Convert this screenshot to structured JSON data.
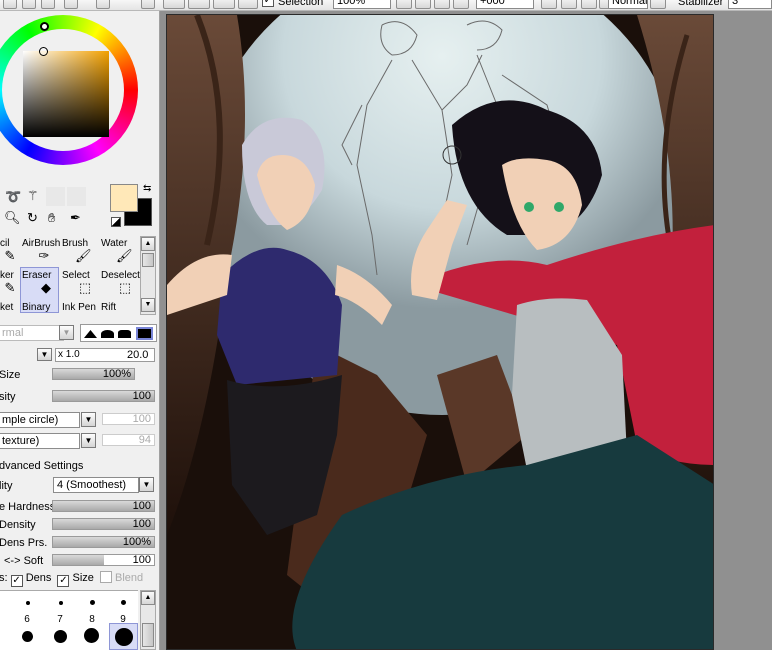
{
  "toolbar": {
    "selection_label": "Selection",
    "selection_checked": "✓",
    "zoom_value": "100%",
    "rotation_value": "+000°",
    "blend_mode": "Normal",
    "stabilizer_label": "Stabilizer",
    "stabilizer_value": "3"
  },
  "colors": {
    "primary": "#ffe8b8",
    "secondary": "#000000",
    "accent_selected": "#d8dcf6"
  },
  "tools": {
    "row1": [
      {
        "label": "cil",
        "icon": "pencil-icon"
      },
      {
        "label": "AirBrush",
        "icon": "airbrush-icon"
      },
      {
        "label": "Brush",
        "icon": "brush-icon"
      },
      {
        "label": "Water",
        "icon": "water-brush-icon"
      }
    ],
    "row2": [
      {
        "label": "ker",
        "icon": "marker-icon"
      },
      {
        "label": "Eraser",
        "icon": "eraser-icon"
      },
      {
        "label": "Select",
        "icon": "select-icon"
      },
      {
        "label": "Deselect",
        "icon": "deselect-icon"
      }
    ],
    "row3": [
      {
        "label": "ket",
        "icon": "bucket-icon"
      },
      {
        "label": "Binary",
        "icon": "binary-icon"
      },
      {
        "label": "Ink Pen",
        "icon": "ink-pen-icon"
      },
      {
        "label": "Rift",
        "icon": "rift-icon"
      }
    ]
  },
  "brush": {
    "blend_mode": "rmal",
    "size_multiplier": "x 1.0",
    "size_value": "20.0",
    "min_size_label": "Size",
    "min_size_value": "100%",
    "min_size_fraction": 1.0,
    "density_label": "sity",
    "density_value": "100",
    "density_fraction": 1.0,
    "shape_dropdown": "mple circle)",
    "shape_value": "100",
    "texture_dropdown": "texture)",
    "texture_value": "94",
    "advanced_label": "dvanced Settings",
    "quality_label": "lity",
    "quality_value": "4 (Smoothest)",
    "hardness_label": "e Hardness",
    "hardness_value": "100",
    "hardness_fraction": 1.0,
    "min_density_label": "Density",
    "min_density_value": "100",
    "min_density_fraction": 1.0,
    "max_dens_label": "Dens Prs.",
    "max_dens_value": "100%",
    "max_dens_fraction": 1.0,
    "hard_soft_label": "<-> Soft",
    "hard_soft_value": "100",
    "hard_soft_fraction": 0.5,
    "pressure_label": "s:",
    "dens_label": "Dens",
    "dens_checked": "✓",
    "size_label": "Size",
    "size_checked": "✓",
    "blend_label": "Blend"
  },
  "brush_sizes": {
    "row1_labels": [
      "",
      "",
      "",
      "",
      ""
    ],
    "row2_labels": [
      "",
      "6",
      "7",
      "8",
      "9"
    ],
    "row3_labels": [
      "",
      "",
      "",
      "",
      ""
    ]
  }
}
